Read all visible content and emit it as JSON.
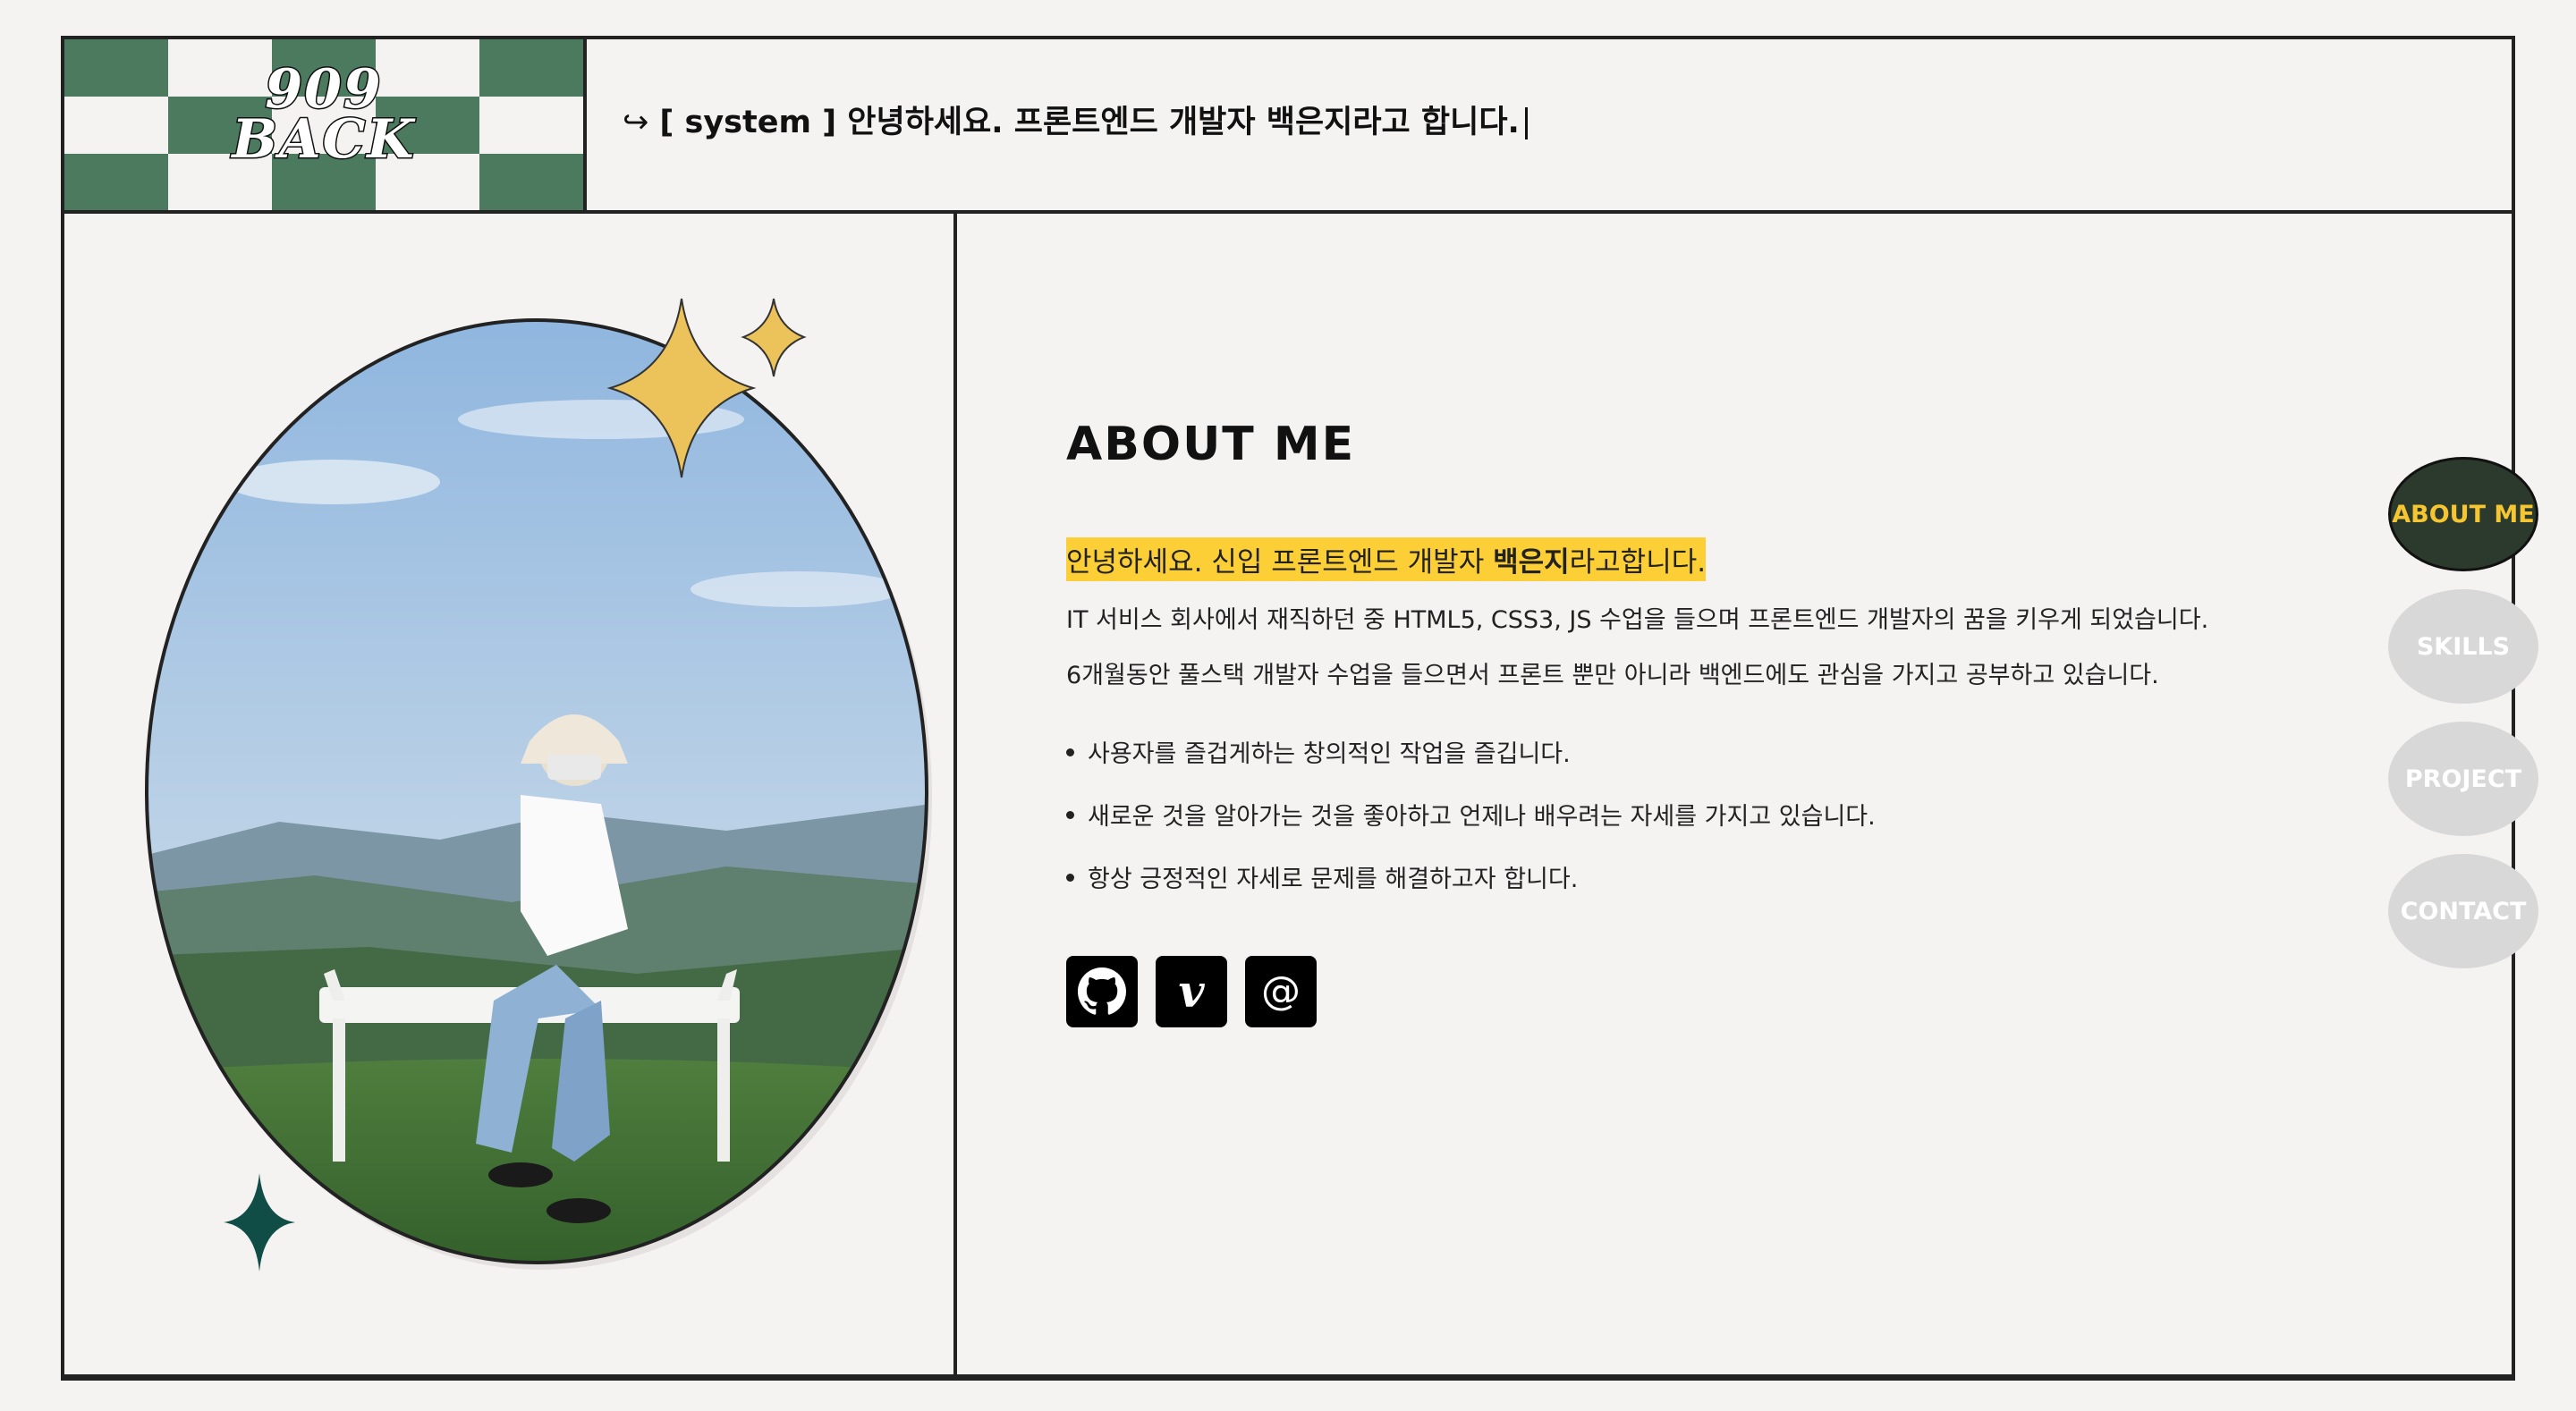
{
  "logo": {
    "line1": "909",
    "line2": "BACK",
    "colors": {
      "green": "#4b7a5e",
      "white": "#f5f3f2"
    }
  },
  "header": {
    "arrow_icon": "return-arrow-icon",
    "system_text": "[ system ] 안녕하세요. 프론트엔드 개발자 백은지라고 합니다."
  },
  "about": {
    "title": "ABOUT ME",
    "intro_prefix": "안녕하세요. 신입 프론트엔드 개발자 ",
    "intro_name": "백은지",
    "intro_suffix": "라고합니다.",
    "paragraphs": [
      "IT 서비스 회사에서 재직하던 중 HTML5, CSS3, JS 수업을 들으며 프론트엔드 개발자의 꿈을 키우게 되었습니다.",
      "6개월동안 풀스택 개발자 수업을 들으면서 프론트 뿐만 아니라 백엔드에도 관심을 가지고 공부하고 있습니다."
    ],
    "bullets": [
      "사용자를 즐겁게하는 창의적인 작업을 즐깁니다.",
      "새로운 것을 알아가는 것을 좋아하고 언제나 배우려는 자세를 가지고 있습니다.",
      "항상 긍정적인 자세로 문제를 해결하고자 합니다."
    ],
    "socials": [
      {
        "icon": "github-icon"
      },
      {
        "icon": "velog-icon",
        "glyph": "v"
      },
      {
        "icon": "email-icon",
        "glyph": "@"
      }
    ],
    "highlight_color": "#fdcf37"
  },
  "nav": {
    "items": [
      {
        "label": "ABOUT ME",
        "active": true
      },
      {
        "label": "SKILLS",
        "active": false
      },
      {
        "label": "PROJECT",
        "active": false
      },
      {
        "label": "CONTACT",
        "active": false
      }
    ],
    "active_color": "#2b3a2c",
    "active_text_color": "#f5c631"
  },
  "photo": {
    "decorations": [
      "sparkle-gold-large-icon",
      "sparkle-gold-small-icon",
      "sparkle-teal-icon"
    ]
  }
}
